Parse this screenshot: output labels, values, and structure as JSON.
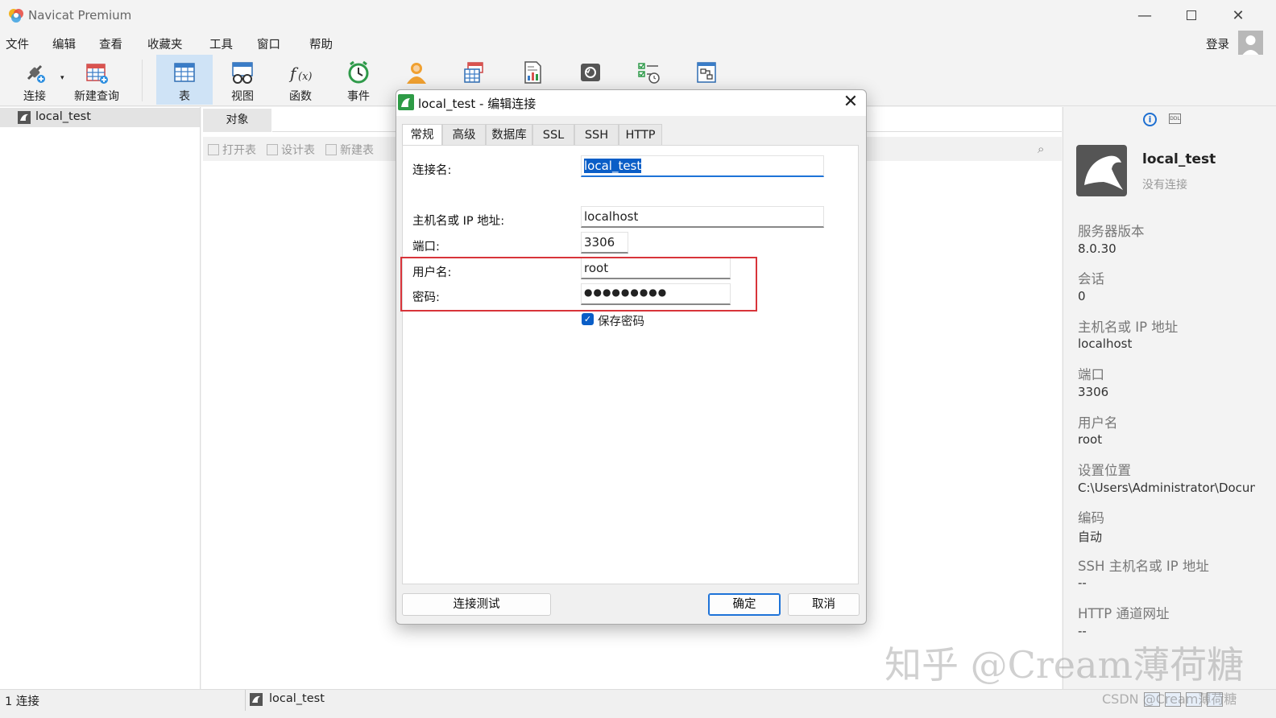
{
  "app": {
    "title": "Navicat Premium"
  },
  "menu": [
    "文件",
    "编辑",
    "查看",
    "收藏夹",
    "工具",
    "窗口",
    "帮助"
  ],
  "account": {
    "login_label": "登录"
  },
  "toolbar": [
    {
      "label": "连接",
      "icon": "plug-icon"
    },
    {
      "label": "新建查询",
      "icon": "new-query-icon"
    },
    {
      "label": "表",
      "icon": "table-icon"
    },
    {
      "label": "视图",
      "icon": "view-icon"
    },
    {
      "label": "函数",
      "icon": "function-icon"
    },
    {
      "label": "事件",
      "icon": "event-clock-icon"
    },
    {
      "label": "",
      "icon": "user-icon"
    },
    {
      "label": "",
      "icon": "query-table-icon"
    },
    {
      "label": "",
      "icon": "report-icon"
    },
    {
      "label": "",
      "icon": "backup-icon"
    },
    {
      "label": "",
      "icon": "schedule-icon"
    },
    {
      "label": "",
      "icon": "model-icon"
    }
  ],
  "nav": {
    "connection": "local_test"
  },
  "objects": {
    "tab_label": "对象",
    "actions": [
      "打开表",
      "设计表",
      "新建表"
    ]
  },
  "dialog": {
    "title": "local_test - 编辑连接",
    "tabs": [
      "常规",
      "高级",
      "数据库",
      "SSL",
      "SSH",
      "HTTP"
    ],
    "fields": {
      "conn_name_label": "连接名:",
      "conn_name_value": "local_test",
      "host_label": "主机名或 IP 地址:",
      "host_value": "localhost",
      "port_label": "端口:",
      "port_value": "3306",
      "user_label": "用户名:",
      "user_value": "root",
      "pw_label": "密码:",
      "pw_value": "●●●●●●●●●"
    },
    "save_password_label": "保存密码",
    "save_password_checked": true,
    "buttons": {
      "test": "连接测试",
      "ok": "确定",
      "cancel": "取消"
    }
  },
  "info_panel": {
    "name": "local_test",
    "state": "没有连接",
    "items": [
      {
        "label": "服务器版本",
        "value": "8.0.30"
      },
      {
        "label": "会话",
        "value": "0"
      },
      {
        "label": "主机名或 IP 地址",
        "value": "localhost"
      },
      {
        "label": "端口",
        "value": "3306"
      },
      {
        "label": "用户名",
        "value": "root"
      },
      {
        "label": "设置位置",
        "value": "C:\\Users\\Administrator\\Documents"
      },
      {
        "label": "编码",
        "value": "自动"
      },
      {
        "label": "SSH 主机名或 IP 地址",
        "value": "--"
      },
      {
        "label": "HTTP 通道网址",
        "value": "--"
      }
    ]
  },
  "status": {
    "count": "1 连接",
    "connection": "local_test"
  },
  "watermark": {
    "main": "知乎 @Cream薄荷糖",
    "sub": "CSDN @Cream薄荷糖"
  },
  "colors": {
    "accent": "#0a5ec7",
    "highlight_box": "#d8343a",
    "active_tool": "#cfe3f6"
  }
}
